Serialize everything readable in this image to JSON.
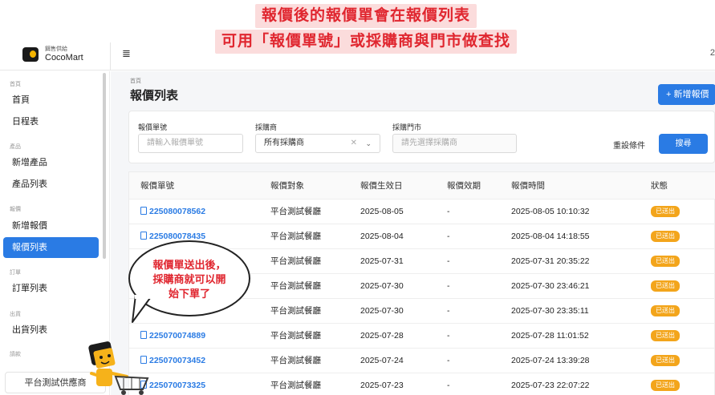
{
  "banner": {
    "line1": "報價後的報價單會在報價列表",
    "line2": "可用「報價單號」或採購商與門市做查找"
  },
  "brand": {
    "sub": "餌售供給",
    "name": "CocoMart"
  },
  "header": {
    "menu_icon": "menu-collapse-icon",
    "user_glyph": "2"
  },
  "sidebar": {
    "groups": {
      "home": "首頁",
      "product": "產品",
      "quote": "報價",
      "order": "訂單",
      "ship": "出貨",
      "reconcile": "請款"
    },
    "items": {
      "home": "首頁",
      "schedule": "日程表",
      "new_product": "新增產品",
      "product_list": "產品列表",
      "new_quote": "新增報價",
      "quote_list": "報價列表",
      "order_list": "訂單列表",
      "ship_list": "出貨列表"
    },
    "footer": "平台測試供應商"
  },
  "main": {
    "breadcrumb": "首頁",
    "title": "報價列表",
    "add_button": "+ 新增報價"
  },
  "filter": {
    "quote_no_label": "報價單號",
    "quote_no_placeholder": "請輸入報價單號",
    "buyer_label": "採購商",
    "buyer_value": "所有採購商",
    "store_label": "採購門市",
    "store_placeholder": "請先選擇採購商",
    "reset": "重設條件",
    "search": "搜尋"
  },
  "table": {
    "headers": [
      "報價單號",
      "報價對象",
      "報價生效日",
      "報價效期",
      "報價時間",
      "狀態"
    ],
    "rows": [
      {
        "no": "225080078562",
        "target": "平台測試餐廳",
        "effective": "2025-08-05",
        "validity": "-",
        "time": "2025-08-05 10:10:32",
        "status": "已送出"
      },
      {
        "no": "225080078435",
        "target": "平台測試餐廳",
        "effective": "2025-08-04",
        "validity": "-",
        "time": "2025-08-04 14:18:55",
        "status": "已送出"
      },
      {
        "no": "",
        "target": "平台測試餐廳",
        "effective": "2025-07-31",
        "validity": "-",
        "time": "2025-07-31 20:35:22",
        "status": "已送出"
      },
      {
        "no": "",
        "target": "平台測試餐廳",
        "effective": "2025-07-30",
        "validity": "-",
        "time": "2025-07-30 23:46:21",
        "status": "已送出"
      },
      {
        "no": "",
        "target": "平台測試餐廳",
        "effective": "2025-07-30",
        "validity": "-",
        "time": "2025-07-30 23:35:11",
        "status": "已送出"
      },
      {
        "no": "225070074889",
        "target": "平台測試餐廳",
        "effective": "2025-07-28",
        "validity": "-",
        "time": "2025-07-28 11:01:52",
        "status": "已送出"
      },
      {
        "no": "225070073452",
        "target": "平台測試餐廳",
        "effective": "2025-07-24",
        "validity": "-",
        "time": "2025-07-24 13:39:28",
        "status": "已送出"
      },
      {
        "no": "225070073325",
        "target": "平台測試餐廳",
        "effective": "2025-07-23",
        "validity": "-",
        "time": "2025-07-23 22:07:22",
        "status": "已送出"
      }
    ]
  },
  "bubble": {
    "line1": "報價單送出後，",
    "line2": "採購商就可以開",
    "line3": "始下單了"
  },
  "colors": {
    "accent": "#2a7be4",
    "badge": "#f3a51b",
    "banner_text": "#e0262f",
    "banner_bg": "#fbdcdc"
  }
}
